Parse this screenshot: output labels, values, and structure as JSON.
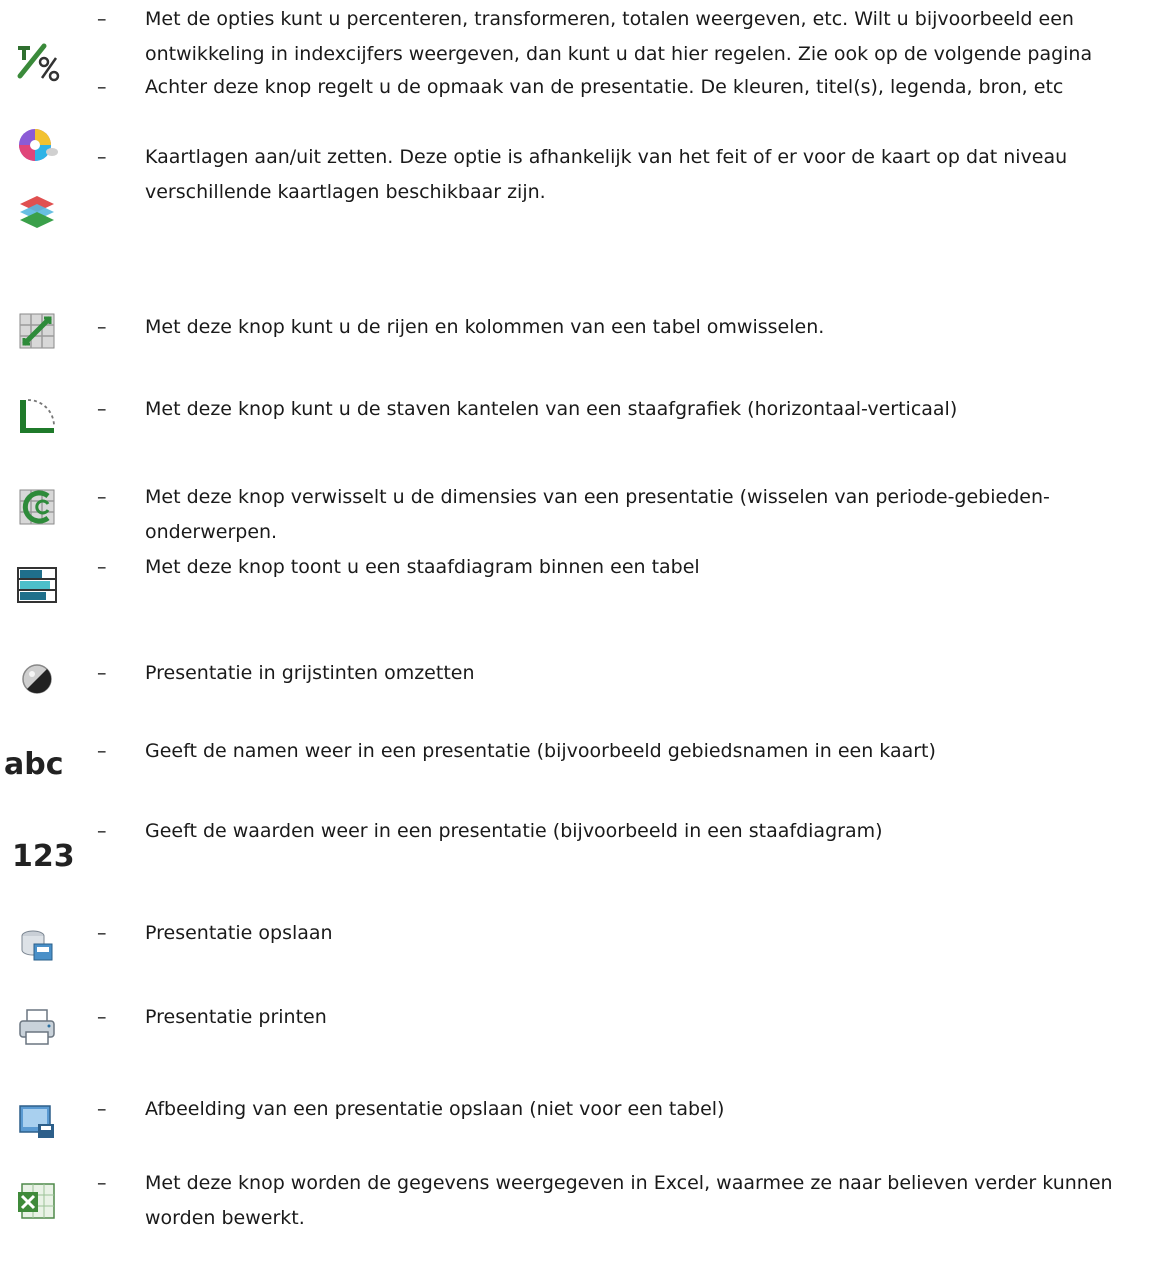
{
  "items": [
    {
      "icon": "percent-transform-icon",
      "dash": "–",
      "text": "Met de opties kunt u percenteren, transformeren, totalen weergeven, etc. Wilt u bijvoorbeeld een ontwikkeling in indexcijfers weergeven, dan kunt u dat hier regelen. Zie ook op de volgende pagina"
    },
    {
      "icon": "color-palette-icon",
      "dash": "–",
      "text": " Achter deze knop regelt u de opmaak van de presentatie. De kleuren, titel(s), legenda, bron, etc"
    },
    {
      "icon": "map-layers-icon",
      "dash": "–",
      "text": "Kaartlagen aan/uit zetten. Deze optie is afhankelijk van het feit of er voor de kaart op dat niveau verschillende kaartlagen beschikbaar zijn."
    },
    {
      "icon": "swap-rows-columns-icon",
      "dash": "–",
      "text": "Met deze knop kunt u de rijen en kolommen van een tabel omwisselen."
    },
    {
      "icon": "rotate-bars-icon",
      "dash": "–",
      "text": "Met deze knop kunt u de staven kantelen van een staafgrafiek (horizontaal-verticaal)"
    },
    {
      "icon": "swap-dimensions-icon",
      "dash": "–",
      "text": "Met deze knop verwisselt u de dimensies van een presentatie (wisselen van periode-gebieden-onderwerpen."
    },
    {
      "icon": "bar-in-table-icon",
      "dash": "–",
      "text": "Met deze knop toont u een staafdiagram binnen een tabel"
    },
    {
      "icon": "grayscale-icon",
      "dash": "–",
      "text": "Presentatie in grijstinten omzetten"
    },
    {
      "icon": "show-names-icon",
      "icon_text": "abc",
      "dash": "–",
      "text": "Geeft de namen weer in een presentatie (bijvoorbeeld gebiedsnamen in een kaart)"
    },
    {
      "icon": "show-values-icon",
      "icon_text": "123",
      "dash": "–",
      "text": "Geeft de waarden weer in een presentatie (bijvoorbeeld in een staafdiagram)"
    },
    {
      "icon": "save-presentation-icon",
      "dash": "–",
      "text": "Presentatie opslaan"
    },
    {
      "icon": "print-icon",
      "dash": "–",
      "text": "Presentatie printen"
    },
    {
      "icon": "save-image-icon",
      "dash": "–",
      "text": "Afbeelding van een presentatie opslaan (niet voor een tabel)"
    },
    {
      "icon": "excel-export-icon",
      "dash": "–",
      "text": "Met deze knop worden de gegevens weergegeven in Excel, waarmee ze naar believen verder kunnen worden bewerkt."
    }
  ]
}
